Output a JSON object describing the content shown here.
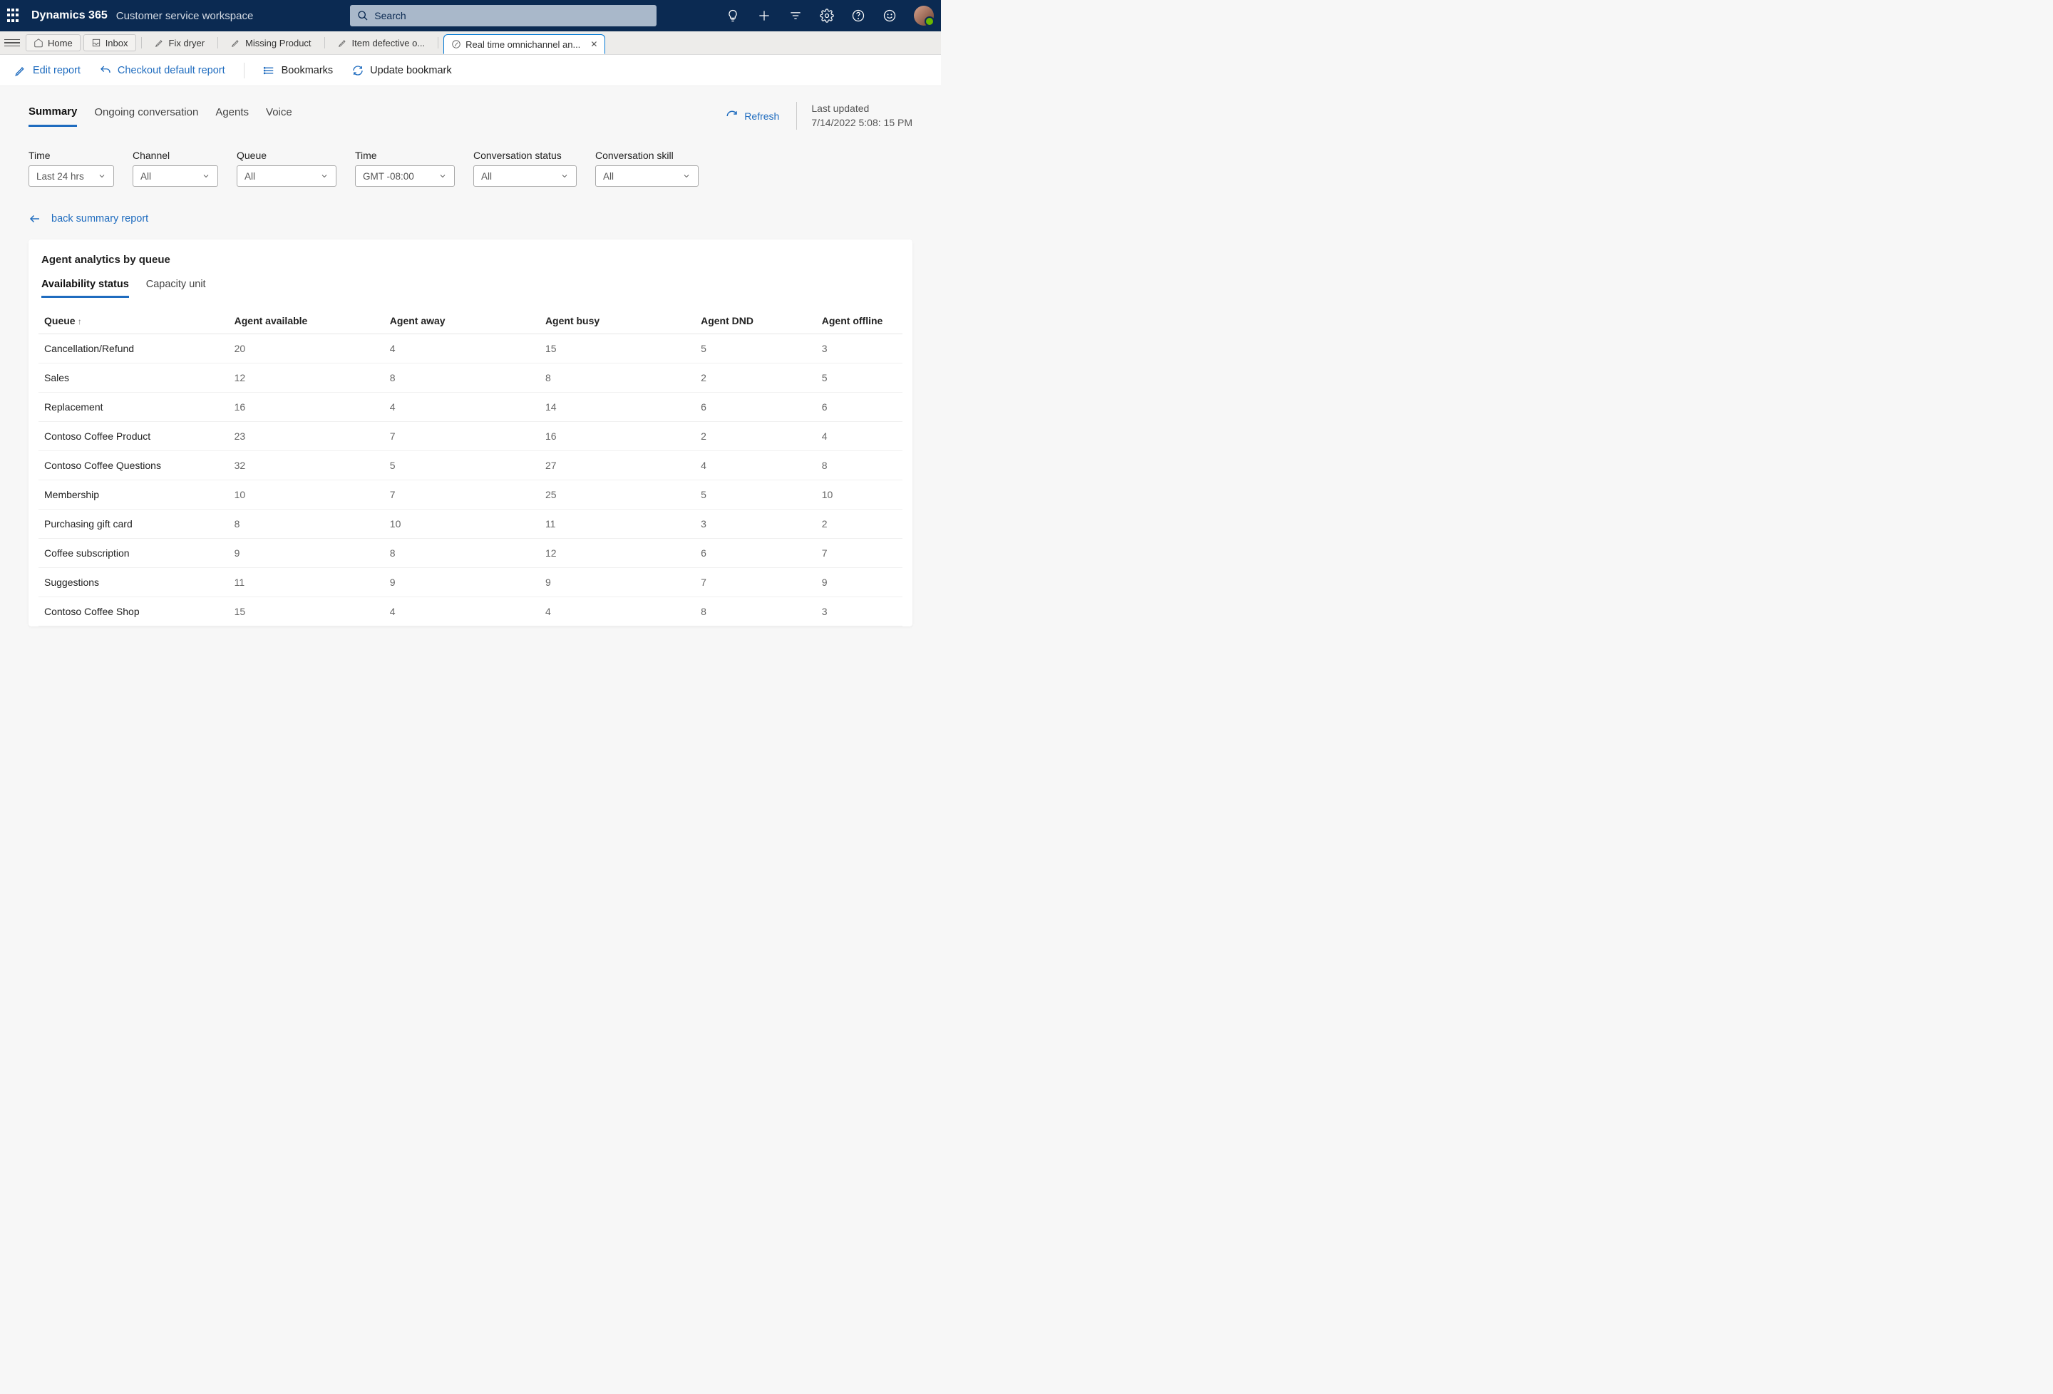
{
  "topbar": {
    "brand": "Dynamics 365",
    "subtitle": "Customer service workspace",
    "search_placeholder": "Search"
  },
  "tabs": {
    "home": "Home",
    "inbox": "Inbox",
    "t1": "Fix dryer",
    "t2": "Missing Product",
    "t3": "Item defective o...",
    "t4": "Real time omnichannel an..."
  },
  "actionbar": {
    "edit": "Edit report",
    "checkout": "Checkout default report",
    "bookmarks": "Bookmarks",
    "update": "Update bookmark"
  },
  "viewtabs": {
    "summary": "Summary",
    "ongoing": "Ongoing conversation",
    "agents": "Agents",
    "voice": "Voice",
    "refresh": "Refresh",
    "last_updated_label": "Last updated",
    "last_updated_value": "7/14/2022 5:08: 15 PM"
  },
  "filters": {
    "time": {
      "label": "Time",
      "value": "Last 24 hrs"
    },
    "channel": {
      "label": "Channel",
      "value": "All"
    },
    "queue": {
      "label": "Queue",
      "value": "All"
    },
    "tz": {
      "label": "Time",
      "value": "GMT -08:00"
    },
    "status": {
      "label": "Conversation status",
      "value": "All"
    },
    "skill": {
      "label": "Conversation skill",
      "value": "All"
    }
  },
  "backlink": "back summary report",
  "card": {
    "title": "Agent analytics by queue",
    "subtabs": {
      "avail": "Availability status",
      "cap": "Capacity unit"
    }
  },
  "table": {
    "headers": {
      "queue": "Queue",
      "avail": "Agent available",
      "away": "Agent away",
      "busy": "Agent busy",
      "dnd": "Agent DND",
      "offline": "Agent offline"
    },
    "rows": [
      {
        "queue": "Cancellation/Refund",
        "avail": "20",
        "away": "4",
        "busy": "15",
        "dnd": "5",
        "offline": "3"
      },
      {
        "queue": "Sales",
        "avail": "12",
        "away": "8",
        "busy": "8",
        "dnd": "2",
        "offline": "5"
      },
      {
        "queue": "Replacement",
        "avail": "16",
        "away": "4",
        "busy": "14",
        "dnd": "6",
        "offline": "6"
      },
      {
        "queue": "Contoso Coffee Product",
        "avail": "23",
        "away": "7",
        "busy": "16",
        "dnd": "2",
        "offline": "4"
      },
      {
        "queue": "Contoso Coffee Questions",
        "avail": "32",
        "away": "5",
        "busy": "27",
        "dnd": "4",
        "offline": "8"
      },
      {
        "queue": "Membership",
        "avail": "10",
        "away": "7",
        "busy": "25",
        "dnd": "5",
        "offline": "10"
      },
      {
        "queue": "Purchasing gift card",
        "avail": "8",
        "away": "10",
        "busy": "11",
        "dnd": "3",
        "offline": "2"
      },
      {
        "queue": "Coffee subscription",
        "avail": "9",
        "away": "8",
        "busy": "12",
        "dnd": "6",
        "offline": "7"
      },
      {
        "queue": "Suggestions",
        "avail": "11",
        "away": "9",
        "busy": "9",
        "dnd": "7",
        "offline": "9"
      },
      {
        "queue": "Contoso Coffee Shop",
        "avail": "15",
        "away": "4",
        "busy": "4",
        "dnd": "8",
        "offline": "3"
      }
    ]
  }
}
